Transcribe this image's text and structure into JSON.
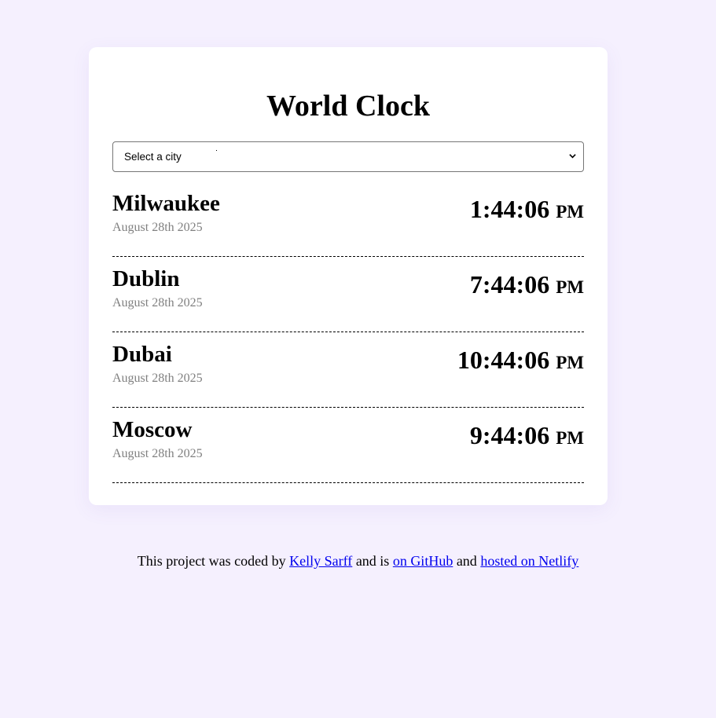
{
  "title": "World Clock",
  "city_select": {
    "selected": "Select a city",
    "options": [
      "Select a city"
    ]
  },
  "cities": [
    {
      "name": "Milwaukee",
      "date": "August 28th 2025",
      "time": "1:44:06",
      "ampm": "PM"
    },
    {
      "name": "Dublin",
      "date": "August 28th 2025",
      "time": "7:44:06",
      "ampm": "PM"
    },
    {
      "name": "Dubai",
      "date": "August 28th 2025",
      "time": "10:44:06",
      "ampm": "PM"
    },
    {
      "name": "Moscow",
      "date": "August 28th 2025",
      "time": "9:44:06",
      "ampm": "PM"
    }
  ],
  "footer": {
    "text_1": "This project was coded by ",
    "link_author": "Kelly Sarff",
    "text_2": " and is ",
    "link_github": "on GitHub",
    "text_3": " and ",
    "link_netlify": "hosted on Netlify"
  },
  "colors": {
    "background": "#f5f0fe",
    "card": "#ffffff",
    "date_text": "#808080",
    "link": "#0000ee"
  }
}
